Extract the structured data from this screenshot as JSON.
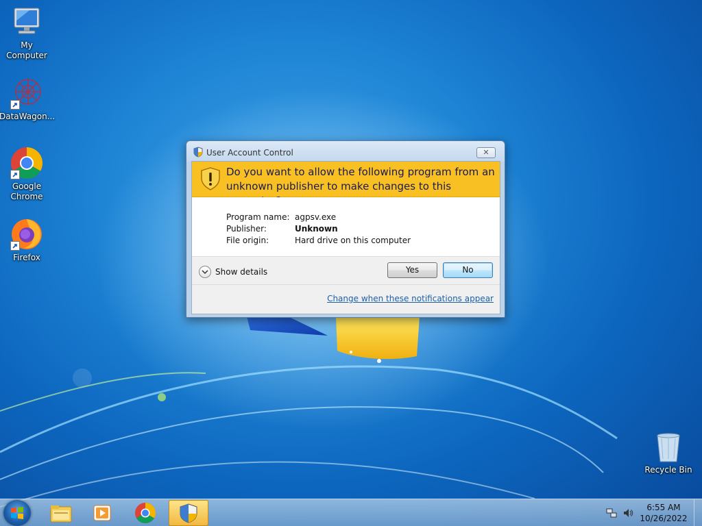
{
  "desktop": {
    "icons": [
      {
        "label": "My Computer"
      },
      {
        "label": "DataWagon..."
      },
      {
        "label": "Google Chrome"
      },
      {
        "label": "Firefox"
      },
      {
        "label": "Recycle Bin"
      }
    ]
  },
  "dialog": {
    "title": "User Account Control",
    "close_glyph": "✕",
    "question": "Do you want to allow the following program from an unknown publisher to make changes to this computer?",
    "program_name_label": "Program name:",
    "program_name": "agpsv.exe",
    "publisher_label": "Publisher:",
    "publisher": "Unknown",
    "file_origin_label": "File origin:",
    "file_origin": "Hard drive on this computer",
    "show_details": "Show details",
    "yes": "Yes",
    "no": "No",
    "change_link": "Change when these notifications appear"
  },
  "taskbar": {
    "time": "6:55 AM",
    "date": "10/26/2022"
  },
  "colors": {
    "banner": "#f9c023",
    "link": "#1d5fa6",
    "desktop": "#1f86d6"
  }
}
